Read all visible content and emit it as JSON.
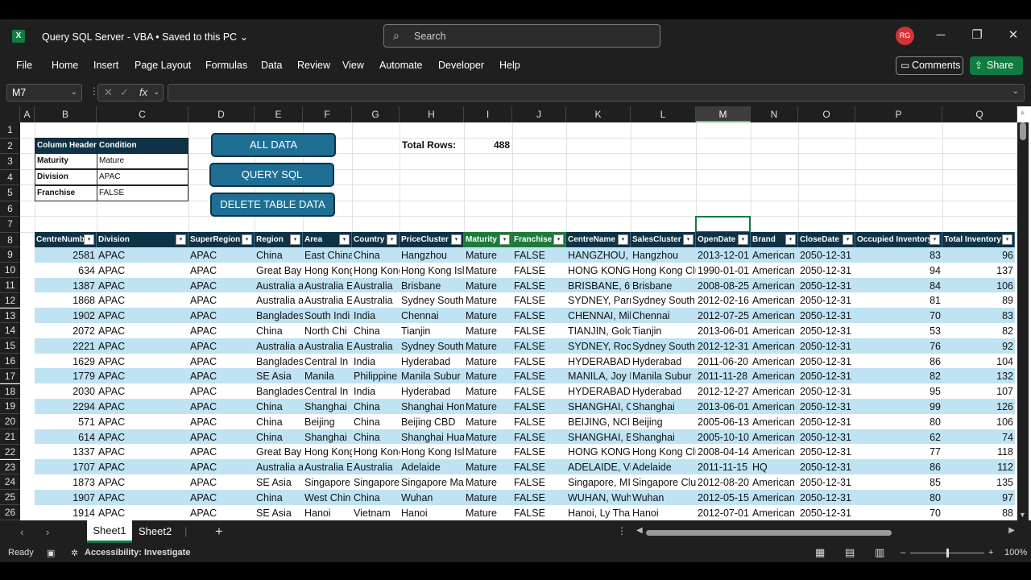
{
  "title": {
    "app_icon": "X",
    "doc": "Query SQL Server - VBA  •  Saved to this PC",
    "search_placeholder": "Search",
    "avatar": "RG"
  },
  "menu": [
    "File",
    "Home",
    "Insert",
    "Page Layout",
    "Formulas",
    "Data",
    "Review",
    "View",
    "Automate",
    "Developer",
    "Help"
  ],
  "actions": {
    "comments": "Comments",
    "share": "Share"
  },
  "formula": {
    "name_box": "M7",
    "content": ""
  },
  "columns": [
    "A",
    "B",
    "C",
    "D",
    "E",
    "F",
    "G",
    "H",
    "I",
    "J",
    "K",
    "L",
    "M",
    "N",
    "O",
    "P",
    "Q"
  ],
  "selected_column": "M",
  "rows": [
    "1",
    "2",
    "3",
    "4",
    "5",
    "6",
    "7",
    "8",
    "9",
    "10",
    "11",
    "12",
    "13",
    "14",
    "15",
    "16",
    "17",
    "18",
    "19",
    "20",
    "21",
    "22",
    "23",
    "24",
    "25",
    "26"
  ],
  "criteria": {
    "header": [
      "Column Header",
      "Condition"
    ],
    "rows": [
      [
        "Maturity",
        "Mature"
      ],
      [
        "Division",
        "APAC"
      ],
      [
        "Franchise",
        "FALSE"
      ]
    ]
  },
  "buttons": {
    "all_data": "ALL DATA",
    "query_sql": "QUERY SQL",
    "delete": "DELETE TABLE DATA"
  },
  "summary": {
    "label": "Total Rows:",
    "value": "488"
  },
  "table_headers": [
    "CentreNumb",
    "Division",
    "SuperRegion",
    "Region",
    "Area",
    "Country",
    "PriceCluster",
    "Maturity",
    "Franchise",
    "CentreName",
    "SalesCluster",
    "OpenDate",
    "Brand",
    "CloseDate",
    "Occupied Inventory",
    "Total Inventory"
  ],
  "table_rows": [
    [
      "2581",
      "APAC",
      "APAC",
      "China",
      "East China",
      "China",
      "Hangzhou",
      "Mature",
      "FALSE",
      "HANGZHOU, D",
      "Hangzhou",
      "2013-12-01",
      "American",
      "2050-12-31",
      "83",
      "96"
    ],
    [
      "634",
      "APAC",
      "APAC",
      "Great Bay",
      "Hong Kong",
      "Hong Kong",
      "Hong Kong Isl",
      "Mature",
      "FALSE",
      "HONG KONG,",
      "Hong Kong Clu",
      "1990-01-01",
      "American",
      "2050-12-31",
      "94",
      "137"
    ],
    [
      "1387",
      "APAC",
      "APAC",
      "Australia a",
      "Australia E",
      "Australia",
      "Brisbane",
      "Mature",
      "FALSE",
      "BRISBANE, 69",
      "Brisbane",
      "2008-08-25",
      "American",
      "2050-12-31",
      "84",
      "106"
    ],
    [
      "1868",
      "APAC",
      "APAC",
      "Australia a",
      "Australia E",
      "Australia",
      "Sydney South",
      "Mature",
      "FALSE",
      "SYDNEY, Parra",
      "Sydney South",
      "2012-02-16",
      "American",
      "2050-12-31",
      "81",
      "89"
    ],
    [
      "1902",
      "APAC",
      "APAC",
      "Banglades",
      "South Indi",
      "India",
      "Chennai",
      "Mature",
      "FALSE",
      "CHENNAI, Mil",
      "Chennai",
      "2012-07-25",
      "American",
      "2050-12-31",
      "70",
      "83"
    ],
    [
      "2072",
      "APAC",
      "APAC",
      "China",
      "North Chi",
      "China",
      "Tianjin",
      "Mature",
      "FALSE",
      "TIANJIN, Gold",
      "Tianjin",
      "2013-06-01",
      "American",
      "2050-12-31",
      "53",
      "82"
    ],
    [
      "2221",
      "APAC",
      "APAC",
      "Australia a",
      "Australia E",
      "Australia",
      "Sydney South",
      "Mature",
      "FALSE",
      "SYDNEY, Rock",
      "Sydney South",
      "2012-12-31",
      "American",
      "2050-12-31",
      "76",
      "92"
    ],
    [
      "1629",
      "APAC",
      "APAC",
      "Banglades",
      "Central In",
      "India",
      "Hyderabad",
      "Mature",
      "FALSE",
      "HYDERABAD, I",
      "Hyderabad",
      "2011-06-20",
      "American",
      "2050-12-31",
      "86",
      "104"
    ],
    [
      "1779",
      "APAC",
      "APAC",
      "SE Asia",
      "Manila",
      "Philippine",
      "Manila Subur",
      "Mature",
      "FALSE",
      "MANILA, Joy N",
      "Manila Subur",
      "2011-11-28",
      "American",
      "2050-12-31",
      "82",
      "132"
    ],
    [
      "2030",
      "APAC",
      "APAC",
      "Banglades",
      "Central In",
      "India",
      "Hyderabad",
      "Mature",
      "FALSE",
      "HYDERABAD, I",
      "Hyderabad",
      "2012-12-27",
      "American",
      "2050-12-31",
      "95",
      "107"
    ],
    [
      "2294",
      "APAC",
      "APAC",
      "China",
      "Shanghai",
      "China",
      "Shanghai Hon",
      "Mature",
      "FALSE",
      "SHANGHAI, C(",
      "Shanghai",
      "2013-06-01",
      "American",
      "2050-12-31",
      "99",
      "126"
    ],
    [
      "571",
      "APAC",
      "APAC",
      "China",
      "Beijing",
      "China",
      "Beijing CBD",
      "Mature",
      "FALSE",
      "BEIJING, NCI (",
      "Beijing",
      "2005-06-13",
      "American",
      "2050-12-31",
      "80",
      "106"
    ],
    [
      "614",
      "APAC",
      "APAC",
      "China",
      "Shanghai",
      "China",
      "Shanghai Hua",
      "Mature",
      "FALSE",
      "SHANGHAI, Bu",
      "Shanghai",
      "2005-10-10",
      "American",
      "2050-12-31",
      "62",
      "74"
    ],
    [
      "1337",
      "APAC",
      "APAC",
      "Great Bay",
      "Hong Kong",
      "Hong Kong",
      "Hong Kong Isl",
      "Mature",
      "FALSE",
      "HONG KONG,",
      "Hong Kong Clu",
      "2008-04-14",
      "American",
      "2050-12-31",
      "77",
      "118"
    ],
    [
      "1707",
      "APAC",
      "APAC",
      "Australia a",
      "Australia E",
      "Australia",
      "Adelaide",
      "Mature",
      "FALSE",
      "ADELAIDE, Vic",
      "Adelaide",
      "2011-11-15",
      "HQ",
      "2050-12-31",
      "86",
      "112"
    ],
    [
      "1873",
      "APAC",
      "APAC",
      "SE Asia",
      "Singapore",
      "Singapore",
      "Singapore Ma",
      "Mature",
      "FALSE",
      "Singapore, MI",
      "Singapore Clu",
      "2012-08-20",
      "American",
      "2050-12-31",
      "85",
      "135"
    ],
    [
      "1907",
      "APAC",
      "APAC",
      "China",
      "West Chin",
      "China",
      "Wuhan",
      "Mature",
      "FALSE",
      "WUHAN, Wuh",
      "Wuhan",
      "2012-05-15",
      "American",
      "2050-12-31",
      "80",
      "97"
    ],
    [
      "1914",
      "APAC",
      "APAC",
      "SE Asia",
      "Hanoi",
      "Vietnam",
      "Hanoi",
      "Mature",
      "FALSE",
      "Hanoi, Ly Tha",
      "Hanoi",
      "2012-07-01",
      "American",
      "2050-12-31",
      "70",
      "88"
    ]
  ],
  "sheets": [
    "Sheet1",
    "Sheet2"
  ],
  "status": {
    "ready": "Ready",
    "accessibility": "Accessibility: Investigate",
    "zoom": "100%"
  },
  "colors": {
    "excel_green": "#107c41",
    "header_navy": "#0e3346",
    "header_green": "#1e7a3a",
    "band_blue": "#bfe3f3",
    "button_blue": "#1f6f95"
  }
}
